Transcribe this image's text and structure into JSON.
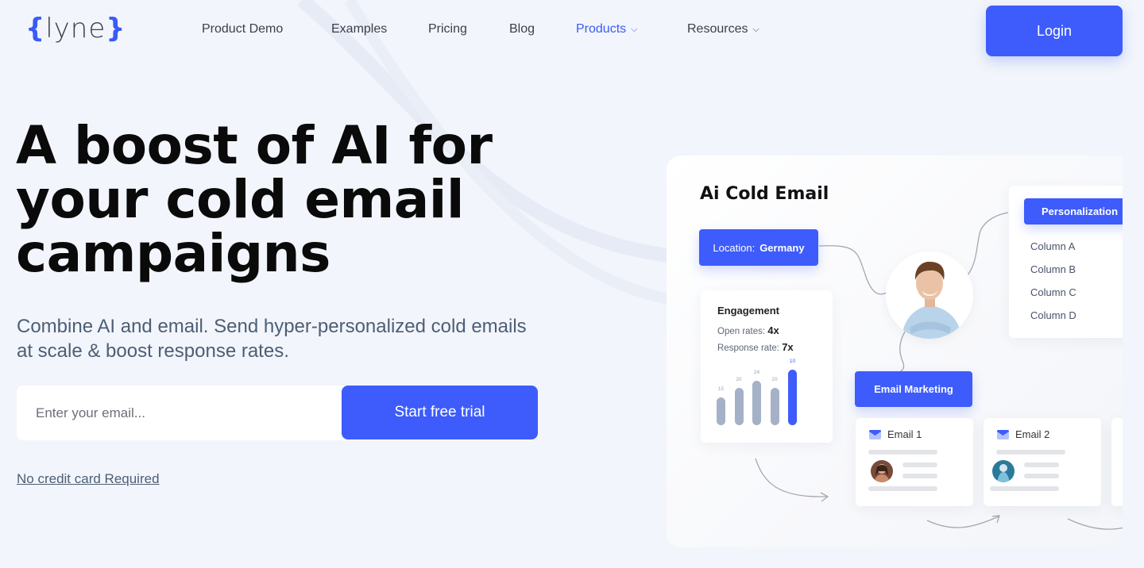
{
  "header": {
    "logo": {
      "open_brace": "{",
      "word": "lyne",
      "close_brace": "}"
    },
    "nav": [
      {
        "label": "Product Demo",
        "active": false,
        "has_dropdown": false
      },
      {
        "label": "Examples",
        "active": false,
        "has_dropdown": false
      },
      {
        "label": "Pricing",
        "active": false,
        "has_dropdown": false
      },
      {
        "label": "Blog",
        "active": false,
        "has_dropdown": false
      },
      {
        "label": "Products",
        "active": true,
        "has_dropdown": true
      },
      {
        "label": "Resources",
        "active": false,
        "has_dropdown": true
      }
    ],
    "chevron": "⌄",
    "login_label": "Login"
  },
  "hero": {
    "title": "A boost of AI for your cold email campaigns",
    "subtitle": "Combine AI and email. Send hyper-personalized cold emails at scale & boost response rates.",
    "email_placeholder": "Enter your email...",
    "email_value": "",
    "cta_label": "Start free trial",
    "note": "No credit card Required"
  },
  "illustration": {
    "title": "Ai Cold Email",
    "location_chip": {
      "key": "Location:",
      "value": "Germany"
    },
    "engagement": {
      "title": "Engagement",
      "open_rates_label": "Open rates:",
      "open_rates_value": "4x",
      "response_rate_label": "Response rate:",
      "response_rate_value": "7x",
      "bars": [
        {
          "label": "15",
          "value": 15,
          "highlight": false
        },
        {
          "label": "20",
          "value": 20,
          "highlight": false
        },
        {
          "label": "24",
          "value": 24,
          "highlight": false
        },
        {
          "label": "20",
          "value": 20,
          "highlight": false
        },
        {
          "label": "10",
          "value": 30,
          "highlight": true
        }
      ]
    },
    "personalization": {
      "label": "Personalization",
      "columns": [
        "Column A",
        "Column B",
        "Column C",
        "Column D"
      ]
    },
    "email_marketing_label": "Email Marketing",
    "emails": [
      {
        "label": "Email 1",
        "avatar_color": "#7a4a3a"
      },
      {
        "label": "Email 2",
        "avatar_color": "#2a7a9a"
      }
    ]
  },
  "colors": {
    "accent": "#3d5cfb",
    "background": "#f2f5fb",
    "subtitle_text": "#4d5e75",
    "bar_muted": "#a5b1c7"
  }
}
